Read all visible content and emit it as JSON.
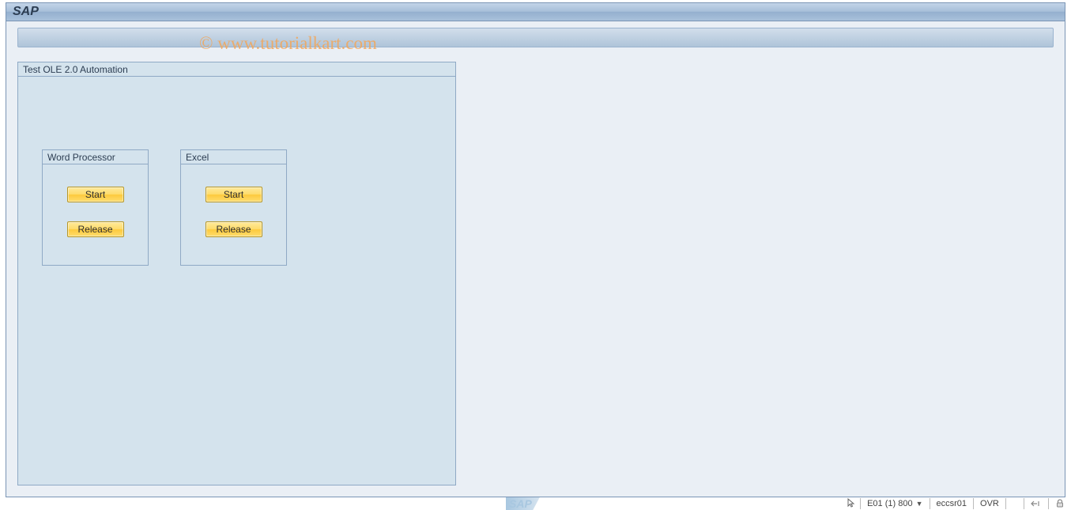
{
  "window": {
    "title": "SAP"
  },
  "watermark": "© www.tutorialkart.com",
  "main_group": {
    "title": "Test OLE 2.0 Automation",
    "panels": [
      {
        "title": "Word Processor",
        "buttons": {
          "start": "Start",
          "release": "Release"
        }
      },
      {
        "title": "Excel",
        "buttons": {
          "start": "Start",
          "release": "Release"
        }
      }
    ]
  },
  "statusbar": {
    "session": "E01 (1) 800",
    "server": "eccsr01",
    "mode": "OVR"
  },
  "sap_logo": "SAP"
}
